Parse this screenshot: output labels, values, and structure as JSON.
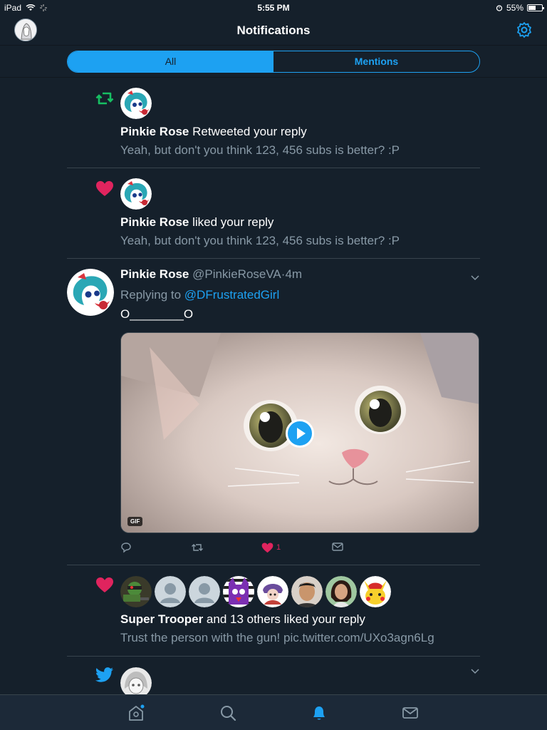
{
  "status_bar": {
    "device": "iPad",
    "time": "5:55 PM",
    "battery_text": "55%",
    "battery_level": 0.55
  },
  "header": {
    "title": "Notifications",
    "avatar_icon": "profile-avatar",
    "settings_icon": "gear-icon"
  },
  "tabs": [
    {
      "label": "All",
      "active": true
    },
    {
      "label": "Mentions",
      "active": false
    }
  ],
  "notifications": [
    {
      "type": "retweet",
      "icon": "retweet-icon",
      "user": "Pinkie Rose",
      "action": " Retweeted your reply",
      "tweet": "Yeah, but don't you think 123, 456 subs is better? :P"
    },
    {
      "type": "like",
      "icon": "heart-icon",
      "user": "Pinkie Rose",
      "action": " liked your reply",
      "tweet": "Yeah, but don't you think 123, 456 subs is better? :P"
    },
    {
      "type": "reply",
      "user": "Pinkie Rose",
      "handle": "@PinkieRoseVA",
      "dot": "·",
      "time": "4m",
      "replying_to_label": "Replying to ",
      "replying_to": "@DFrustratedGirl",
      "body": "O________O",
      "media_badge": "GIF",
      "like_count": "1"
    },
    {
      "type": "like-group",
      "icon": "heart-icon",
      "user": "Super Trooper",
      "action": " and 13 others liked your reply",
      "tweet": "Trust the person with the gun! pic.twitter.com/UXo3agn6Lg",
      "avatars": [
        "soldier-avatar",
        "default-avatar",
        "default-avatar",
        "cartoon-avatar",
        "character-avatar",
        "person-avatar",
        "person-avatar-2",
        "pikachu-avatar"
      ]
    },
    {
      "type": "twitter",
      "icon": "twitter-bird-icon"
    }
  ],
  "tab_bar": [
    "home-icon",
    "search-icon",
    "notifications-icon",
    "messages-icon"
  ],
  "colors": {
    "background": "#15202b",
    "accent": "#1da1f2",
    "like": "#e0245e",
    "retweet": "#17bf63",
    "muted": "#8899a6"
  }
}
